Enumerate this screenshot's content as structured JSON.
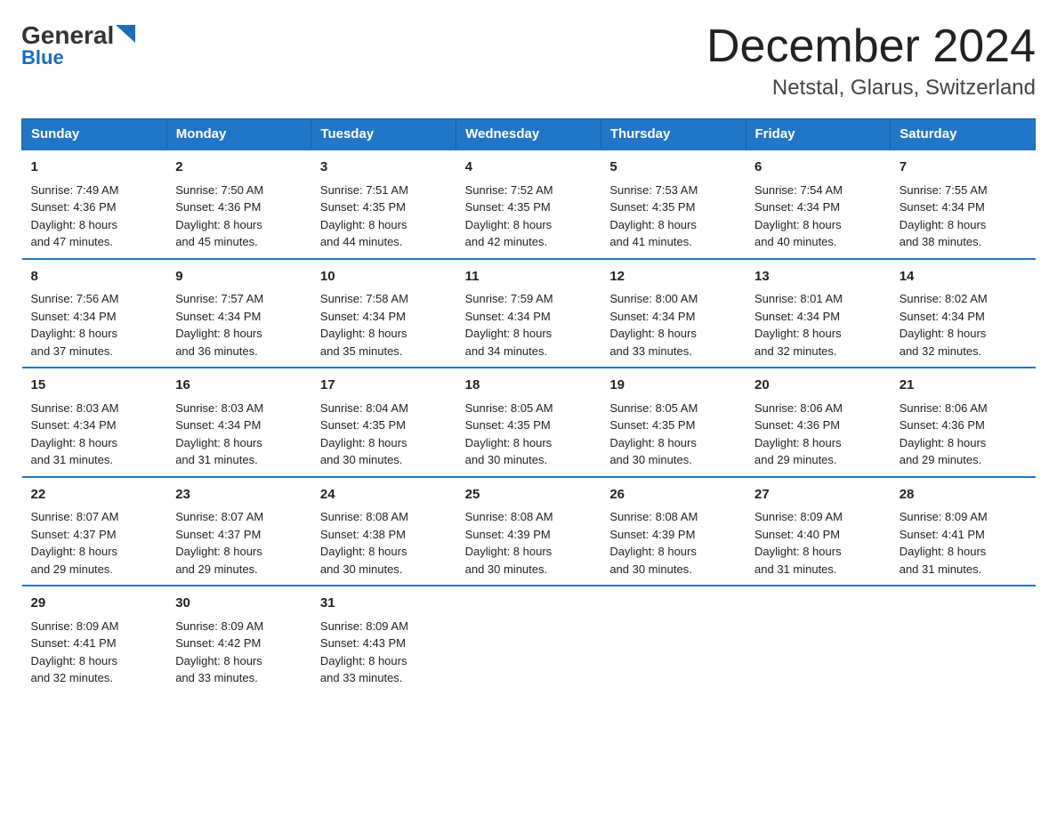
{
  "header": {
    "logo_general": "General",
    "logo_blue": "Blue",
    "title": "December 2024",
    "subtitle": "Netstal, Glarus, Switzerland"
  },
  "weekdays": [
    "Sunday",
    "Monday",
    "Tuesday",
    "Wednesday",
    "Thursday",
    "Friday",
    "Saturday"
  ],
  "weeks": [
    [
      {
        "day": "1",
        "sunrise": "7:49 AM",
        "sunset": "4:36 PM",
        "daylight": "8 hours and 47 minutes."
      },
      {
        "day": "2",
        "sunrise": "7:50 AM",
        "sunset": "4:36 PM",
        "daylight": "8 hours and 45 minutes."
      },
      {
        "day": "3",
        "sunrise": "7:51 AM",
        "sunset": "4:35 PM",
        "daylight": "8 hours and 44 minutes."
      },
      {
        "day": "4",
        "sunrise": "7:52 AM",
        "sunset": "4:35 PM",
        "daylight": "8 hours and 42 minutes."
      },
      {
        "day": "5",
        "sunrise": "7:53 AM",
        "sunset": "4:35 PM",
        "daylight": "8 hours and 41 minutes."
      },
      {
        "day": "6",
        "sunrise": "7:54 AM",
        "sunset": "4:34 PM",
        "daylight": "8 hours and 40 minutes."
      },
      {
        "day": "7",
        "sunrise": "7:55 AM",
        "sunset": "4:34 PM",
        "daylight": "8 hours and 38 minutes."
      }
    ],
    [
      {
        "day": "8",
        "sunrise": "7:56 AM",
        "sunset": "4:34 PM",
        "daylight": "8 hours and 37 minutes."
      },
      {
        "day": "9",
        "sunrise": "7:57 AM",
        "sunset": "4:34 PM",
        "daylight": "8 hours and 36 minutes."
      },
      {
        "day": "10",
        "sunrise": "7:58 AM",
        "sunset": "4:34 PM",
        "daylight": "8 hours and 35 minutes."
      },
      {
        "day": "11",
        "sunrise": "7:59 AM",
        "sunset": "4:34 PM",
        "daylight": "8 hours and 34 minutes."
      },
      {
        "day": "12",
        "sunrise": "8:00 AM",
        "sunset": "4:34 PM",
        "daylight": "8 hours and 33 minutes."
      },
      {
        "day": "13",
        "sunrise": "8:01 AM",
        "sunset": "4:34 PM",
        "daylight": "8 hours and 32 minutes."
      },
      {
        "day": "14",
        "sunrise": "8:02 AM",
        "sunset": "4:34 PM",
        "daylight": "8 hours and 32 minutes."
      }
    ],
    [
      {
        "day": "15",
        "sunrise": "8:03 AM",
        "sunset": "4:34 PM",
        "daylight": "8 hours and 31 minutes."
      },
      {
        "day": "16",
        "sunrise": "8:03 AM",
        "sunset": "4:34 PM",
        "daylight": "8 hours and 31 minutes."
      },
      {
        "day": "17",
        "sunrise": "8:04 AM",
        "sunset": "4:35 PM",
        "daylight": "8 hours and 30 minutes."
      },
      {
        "day": "18",
        "sunrise": "8:05 AM",
        "sunset": "4:35 PM",
        "daylight": "8 hours and 30 minutes."
      },
      {
        "day": "19",
        "sunrise": "8:05 AM",
        "sunset": "4:35 PM",
        "daylight": "8 hours and 30 minutes."
      },
      {
        "day": "20",
        "sunrise": "8:06 AM",
        "sunset": "4:36 PM",
        "daylight": "8 hours and 29 minutes."
      },
      {
        "day": "21",
        "sunrise": "8:06 AM",
        "sunset": "4:36 PM",
        "daylight": "8 hours and 29 minutes."
      }
    ],
    [
      {
        "day": "22",
        "sunrise": "8:07 AM",
        "sunset": "4:37 PM",
        "daylight": "8 hours and 29 minutes."
      },
      {
        "day": "23",
        "sunrise": "8:07 AM",
        "sunset": "4:37 PM",
        "daylight": "8 hours and 29 minutes."
      },
      {
        "day": "24",
        "sunrise": "8:08 AM",
        "sunset": "4:38 PM",
        "daylight": "8 hours and 30 minutes."
      },
      {
        "day": "25",
        "sunrise": "8:08 AM",
        "sunset": "4:39 PM",
        "daylight": "8 hours and 30 minutes."
      },
      {
        "day": "26",
        "sunrise": "8:08 AM",
        "sunset": "4:39 PM",
        "daylight": "8 hours and 30 minutes."
      },
      {
        "day": "27",
        "sunrise": "8:09 AM",
        "sunset": "4:40 PM",
        "daylight": "8 hours and 31 minutes."
      },
      {
        "day": "28",
        "sunrise": "8:09 AM",
        "sunset": "4:41 PM",
        "daylight": "8 hours and 31 minutes."
      }
    ],
    [
      {
        "day": "29",
        "sunrise": "8:09 AM",
        "sunset": "4:41 PM",
        "daylight": "8 hours and 32 minutes."
      },
      {
        "day": "30",
        "sunrise": "8:09 AM",
        "sunset": "4:42 PM",
        "daylight": "8 hours and 33 minutes."
      },
      {
        "day": "31",
        "sunrise": "8:09 AM",
        "sunset": "4:43 PM",
        "daylight": "8 hours and 33 minutes."
      },
      null,
      null,
      null,
      null
    ]
  ],
  "labels": {
    "sunrise": "Sunrise:",
    "sunset": "Sunset:",
    "daylight": "Daylight:"
  }
}
